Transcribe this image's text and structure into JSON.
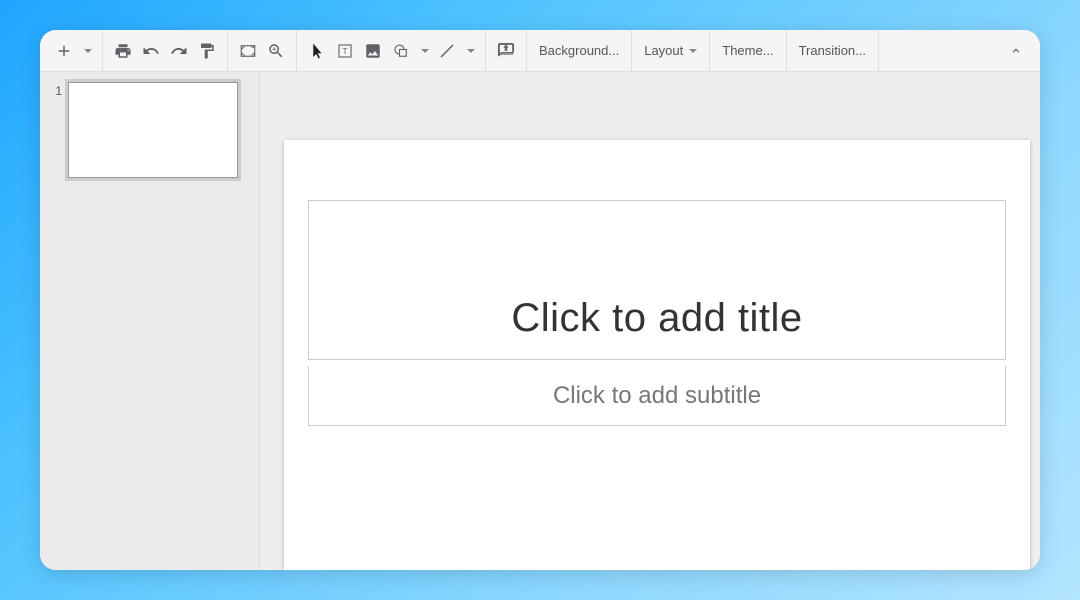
{
  "toolbar": {
    "text_buttons": {
      "background": "Background...",
      "layout": "Layout",
      "theme": "Theme...",
      "transition": "Transition..."
    }
  },
  "sidebar": {
    "slides": [
      {
        "number": "1"
      }
    ]
  },
  "slide": {
    "title_placeholder": "Click to add title",
    "subtitle_placeholder": "Click to add subtitle"
  }
}
